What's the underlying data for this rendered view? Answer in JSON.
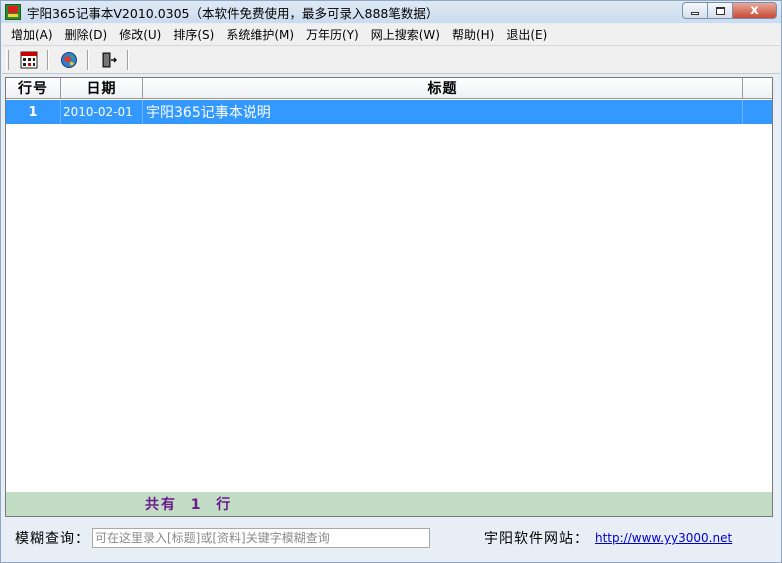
{
  "window": {
    "title": "宇阳365记事本V2010.0305（本软件免费使用，最多可录入888笔数据）",
    "close_label": "x"
  },
  "menu": {
    "items": [
      "增加(A)",
      "删除(D)",
      "修改(U)",
      "排序(S)",
      "系统维护(M)",
      "万年历(Y)",
      "网上搜索(W)",
      "帮助(H)",
      "退出(E)"
    ]
  },
  "toolbar": {
    "icons": [
      "calendar-icon",
      "globe-icon",
      "exit-door-icon"
    ]
  },
  "table": {
    "columns": [
      "行号",
      "日期",
      "标题"
    ],
    "rows": [
      {
        "row_no": "1",
        "date": "2010-02-01",
        "title": "宇阳365记事本说明",
        "selected": true
      }
    ],
    "status": "共有  1  行",
    "selection_color": "#3399ff",
    "status_color": "#c2dcc6"
  },
  "search": {
    "label": "模糊查询：",
    "placeholder": "可在这里录入[标题]或[资料]关键字模糊查询"
  },
  "site": {
    "label": "宇阳软件网站：",
    "url": "http://www.yy3000.net"
  }
}
